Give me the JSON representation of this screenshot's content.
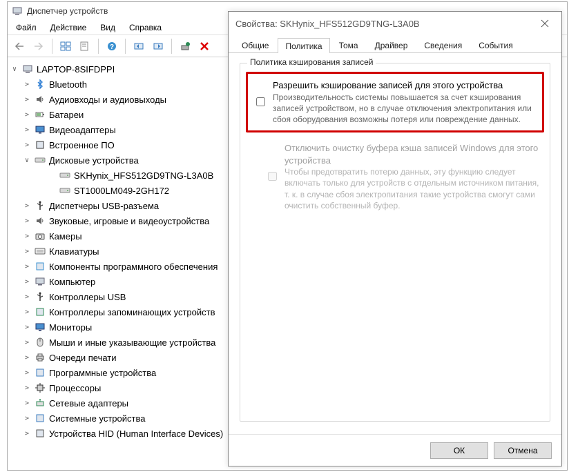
{
  "device_manager": {
    "title": "Диспетчер устройств",
    "menu": {
      "file": "Файл",
      "action": "Действие",
      "view": "Вид",
      "help": "Справка"
    },
    "root": "LAPTOP-8SIFDPPI",
    "categories": [
      {
        "label": "Bluetooth",
        "icon": "bluetooth"
      },
      {
        "label": "Аудиовходы и аудиовыходы",
        "icon": "audio"
      },
      {
        "label": "Батареи",
        "icon": "battery"
      },
      {
        "label": "Видеоадаптеры",
        "icon": "display"
      },
      {
        "label": "Встроенное ПО",
        "icon": "firmware"
      },
      {
        "label": "Дисковые устройства",
        "icon": "disk",
        "expanded": true,
        "children": [
          {
            "label": "SKHynix_HFS512GD9TNG-L3A0B",
            "icon": "disk"
          },
          {
            "label": "ST1000LM049-2GH172",
            "icon": "disk"
          }
        ]
      },
      {
        "label": "Диспетчеры USB-разъема",
        "icon": "usb"
      },
      {
        "label": "Звуковые, игровые и видеоустройства",
        "icon": "sound"
      },
      {
        "label": "Камеры",
        "icon": "camera"
      },
      {
        "label": "Клавиатуры",
        "icon": "keyboard"
      },
      {
        "label": "Компоненты программного обеспечения",
        "icon": "component"
      },
      {
        "label": "Компьютер",
        "icon": "computer"
      },
      {
        "label": "Контроллеры USB",
        "icon": "usb"
      },
      {
        "label": "Контроллеры запоминающих устройств",
        "icon": "storage"
      },
      {
        "label": "Мониторы",
        "icon": "monitor"
      },
      {
        "label": "Мыши и иные указывающие устройства",
        "icon": "mouse"
      },
      {
        "label": "Очереди печати",
        "icon": "printer"
      },
      {
        "label": "Программные устройства",
        "icon": "software"
      },
      {
        "label": "Процессоры",
        "icon": "cpu"
      },
      {
        "label": "Сетевые адаптеры",
        "icon": "network"
      },
      {
        "label": "Системные устройства",
        "icon": "system"
      },
      {
        "label": "Устройства HID (Human Interface Devices)",
        "icon": "hid"
      }
    ]
  },
  "properties": {
    "title": "Свойства: SKHynix_HFS512GD9TNG-L3A0B",
    "tabs": {
      "general": "Общие",
      "policy": "Политика",
      "volumes": "Тома",
      "driver": "Драйвер",
      "details": "Сведения",
      "events": "События"
    },
    "active_tab": "policy",
    "policy": {
      "group_title": "Политика кэширования записей",
      "opt1": {
        "label": "Разрешить кэширование записей для этого устройства",
        "desc": "Производительность системы повышается за счет кэширования записей устройством, но в случае отключения электропитания или сбоя оборудования возможны потеря или повреждение данных.",
        "checked": false
      },
      "opt2": {
        "label": "Отключить очистку буфера кэша записей Windows для этого устройства",
        "desc": "Чтобы предотвратить потерю данных, эту функцию следует включать только для устройств с отдельным источником питания, т. к.  в случае сбоя электропитания такие устройства смогут сами очистить собственный буфер.",
        "checked": false,
        "disabled": true
      }
    },
    "buttons": {
      "ok": "ОК",
      "cancel": "Отмена"
    }
  },
  "icons": {
    "bluetooth": "#2b7cd3",
    "audio": "#444",
    "battery": "#666",
    "display": "#3a7bbf",
    "firmware": "#333",
    "disk": "#888",
    "usb": "#333",
    "sound": "#555",
    "camera": "#555",
    "keyboard": "#555",
    "component": "#3a90d0",
    "computer": "#555",
    "storage": "#2e8b57",
    "monitor": "#3a7bbf",
    "mouse": "#666",
    "printer": "#555",
    "software": "#3a7bbf",
    "cpu": "#333",
    "network": "#2e8b57",
    "system": "#3a7bbf",
    "hid": "#555"
  }
}
